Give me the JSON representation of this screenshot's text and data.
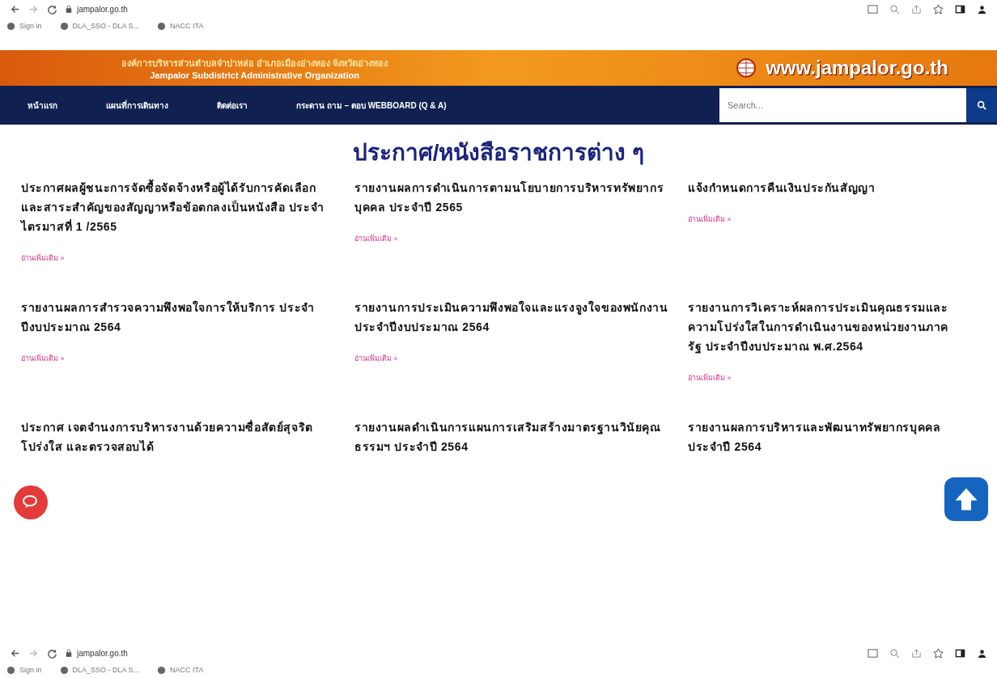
{
  "browser_top": {
    "host": "jampalor.go.th",
    "bookmarks": [
      {
        "label": "Sign in"
      },
      {
        "label": "DLA_SSO - DLA S..."
      },
      {
        "label": "NACC ITA"
      }
    ]
  },
  "header": {
    "org_thai": "องค์การบริหารส่วนตำบลจำปาหล่อ อำเภอเมืองอ่างทอง จังหวัดอ่างทอง",
    "org_english": "Jampalor Subdistrict Administrative Organization",
    "website": "www.jampalor.go.th"
  },
  "nav": {
    "items": [
      {
        "label": "หน้าแรก"
      },
      {
        "label": "แผนที่การเดินทาง"
      },
      {
        "label": "ติดต่อเรา"
      },
      {
        "label": "กระดาน ถาม – ตอบ WEBBOARD (Q & A)"
      }
    ],
    "search": {
      "placeholder": "Search..."
    }
  },
  "page_title": "ประกาศ/หนังสือราชการต่าง ๆ",
  "posts": [
    {
      "title": "ประกาศผลผู้ชนะการจัดซื้อจัดจ้างหรือผู้ได้รับการคัดเลือก และสาระสำคัญของสัญญาหรือข้อตกลงเป็นหนังสือ ประจำไตรมาสที่ 1 /2565",
      "read_more": "อ่านเพิ่มเติม »"
    },
    {
      "title": "รายงานผลการดำเนินการตามนโยบายการบริหารทรัพยากรบุคคล ประจำปี 2565",
      "read_more": "อ่านเพิ่มเติม »"
    },
    {
      "title": "แจ้งกำหนดการคืนเงินประกันสัญญา",
      "read_more": "อ่านเพิ่มเติม »"
    },
    {
      "title": "รายงานผลการสำรวจความพึงพอใจการให้บริการ ประจำปีงบประมาณ 2564",
      "read_more": "อ่านเพิ่มเติม »"
    },
    {
      "title": "รายงานการประเมินความพึงพอใจและแรงจูงใจของพนักงาน ประจำปีงบประมาณ 2564",
      "read_more": "อ่านเพิ่มเติม »"
    },
    {
      "title": "รายงานการวิเคราะห์ผลการประเมินคุณธรรมและความโปร่งใสในการดำเนินงานของหน่วยงานภาครัฐ ประจำปีงบประมาณ พ.ศ.2564",
      "read_more": "อ่านเพิ่มเติม »"
    },
    {
      "title": "ประกาศ เจตจำนงการบริหารงานด้วยความซื่อสัตย์สุจริต โปร่งใส และตรวจสอบได้"
    },
    {
      "title": "รายงานผลดำเนินการแผนการเสริมสร้างมาตรฐานวินัยคุณธรรมฯ ประจำปี 2564"
    },
    {
      "title": "รายงานผลการบริหารและพัฒนาทรัพยากรบุคคลประจำปี 2564"
    }
  ],
  "browser_bottom": {
    "host": "jampalor.go.th",
    "bookmarks": [
      {
        "label": "Sign in"
      },
      {
        "label": "DLA_SSO - DLA S..."
      },
      {
        "label": "NACC ITA"
      }
    ]
  }
}
